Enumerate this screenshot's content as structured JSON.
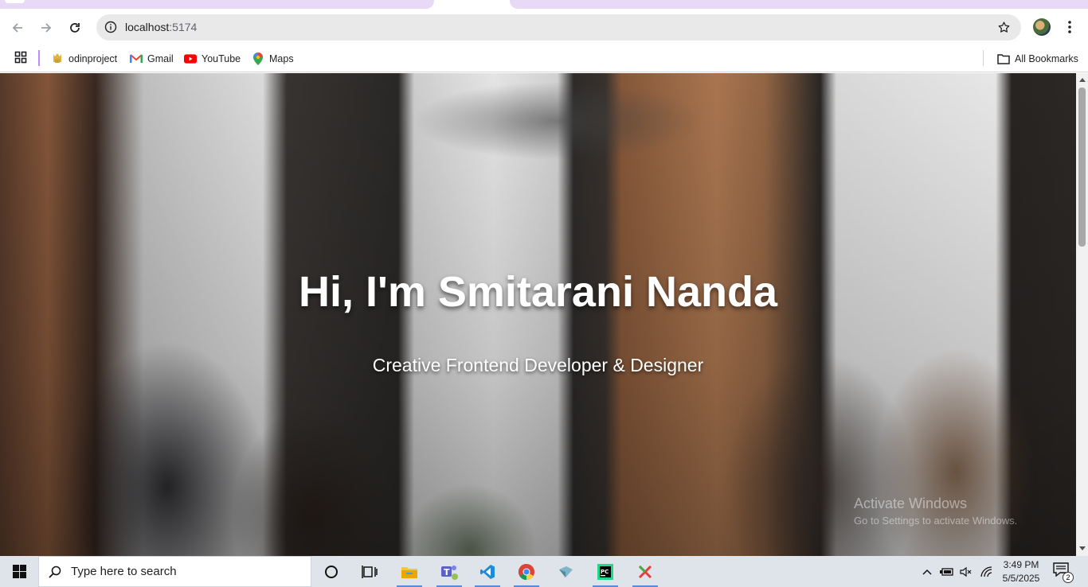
{
  "browser": {
    "address": {
      "host": "localhost",
      "port": ":5174"
    },
    "bookmarks": [
      {
        "label": "odinproject"
      },
      {
        "label": "Gmail"
      },
      {
        "label": "YouTube"
      },
      {
        "label": "Maps"
      }
    ],
    "all_bookmarks_label": "All Bookmarks"
  },
  "hero": {
    "title": "Hi, I'm Smitarani Nanda",
    "subtitle": "Creative Frontend Developer & Designer"
  },
  "watermark": {
    "line1": "Activate Windows",
    "line2": "Go to Settings to activate Windows."
  },
  "taskbar": {
    "search_placeholder": "Type here to search",
    "time": "3:49 PM",
    "date": "5/5/2025",
    "notification_count": "2"
  },
  "colors": {
    "tab_accent": "#e8d9f7",
    "taskbar_bg": "#dfe3ea"
  }
}
